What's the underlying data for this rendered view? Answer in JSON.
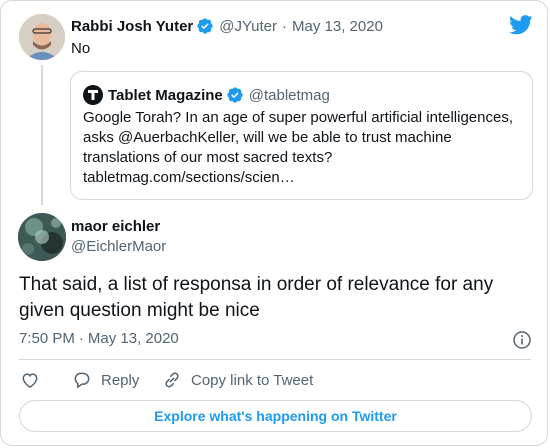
{
  "colors": {
    "brand": "#1d9bf0",
    "text": "#0f1419",
    "muted": "#536471",
    "border": "#cfd9de"
  },
  "parent_tweet": {
    "author_name": "Rabbi Josh Yuter",
    "handle": "@JYuter",
    "separator": "·",
    "date": "May 13, 2020",
    "text": "No",
    "avatar_icon": "user-avatar"
  },
  "quoted_tweet": {
    "author_name": "Tablet Magazine",
    "handle": "@tabletmag",
    "text": "Google Torah? In an age of super powerful artificial intelligences, asks @AuerbachKeller, will we be able to trust machine translations of our most sacred texts?",
    "link": "tabletmag.com/sections/scien…",
    "logo_icon": "tablet-logo-icon"
  },
  "main_tweet": {
    "author_name": "maor eichler",
    "handle": "@EichlerMaor",
    "text": "That said, a list of responsa in order of relevance for any given question might be nice",
    "time": "7:50 PM",
    "separator": "·",
    "date": "May 13, 2020"
  },
  "actions": {
    "reply_label": "Reply",
    "copy_label": "Copy link to Tweet"
  },
  "explore_label": "Explore what's happening on Twitter",
  "icons": [
    "twitter-bird-icon",
    "verified-badge-icon",
    "info-icon",
    "heart-icon",
    "reply-icon",
    "link-icon"
  ]
}
